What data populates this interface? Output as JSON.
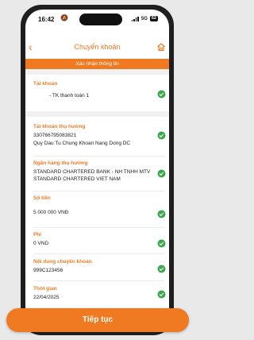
{
  "status": {
    "time": "16:42",
    "network": "5G",
    "battery": "62"
  },
  "nav": {
    "title": "Chuyển khoản",
    "back": "‹"
  },
  "banner": "Xác nhận thông tin",
  "source_account": {
    "label": "Tài khoản",
    "value": "- TK thanh toán 1"
  },
  "fields": [
    {
      "label": "Tài khoản thụ hưởng",
      "value": "330766795083821",
      "value2": "Quy Dau Tu Chung Khoan Nang Dong DC"
    },
    {
      "label": "Ngân hàng thụ hưởng",
      "value": "STANDARD CHARTERED BANK - NH TNHH MTV STANDARD CHARTERED VIET NAM",
      "value2": ""
    },
    {
      "label": "Số tiền",
      "value": "5 000 000  VNĐ",
      "value2": ""
    },
    {
      "label": "Phí",
      "value": "0 VND",
      "value2": ""
    },
    {
      "label": "Nội dung chuyển khoản",
      "value": "999C123456",
      "value2": ""
    },
    {
      "label": "Thời gian",
      "value": "22/04/2025",
      "value2": ""
    }
  ],
  "continue_label": "Tiếp tục",
  "accent_color": "#f07a22",
  "check_color": "#3aa94a"
}
